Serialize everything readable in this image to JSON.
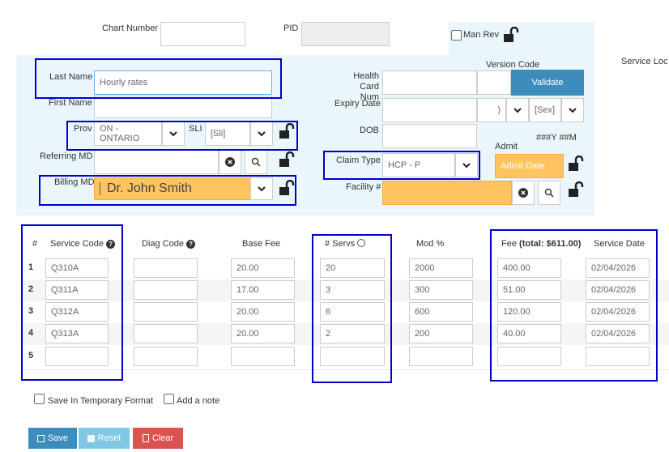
{
  "header": {
    "chart_number_label": "Chart Number",
    "pid_label": "PID",
    "man_rev_label": "Man Rev",
    "version_code_label": "Version Code",
    "service_loc_label": "Service Loc"
  },
  "form": {
    "last_name_label": "Last Name",
    "last_name_value": "Hourly rates",
    "first_name_label": "First Name",
    "prov_label": "Prov",
    "prov_value": "ON - ONTARIO",
    "sli_label": "SLI",
    "sli_value": "[Sli]",
    "referring_md_label": "Referring MD",
    "billing_md_label": "Billing MD",
    "billing_md_value": "Dr. John Smith",
    "health_card_label_1": "Health Card",
    "health_card_label_2": "Num",
    "validate_label": "Validate",
    "expiry_date_label": "Expiry Date",
    "expiry_suffix": ")",
    "sex_value": "[Sex]",
    "dob_label": "DOB",
    "dob_format": "###Y ##M",
    "admit_label": "Admit",
    "claim_type_label": "Claim Type",
    "claim_type_value": "HCP - P",
    "admit_date_placeholder": "Admit Date",
    "facility_label": "Facility #"
  },
  "table": {
    "headers": {
      "num": "#",
      "service_code": "Service Code",
      "diag_code": "Diag Code",
      "base_fee": "Base Fee",
      "servs": "# Servs",
      "mod": "Mod %",
      "fee": "Fee",
      "fee_total": "(total: $611.00)",
      "service_date": "Service Date"
    },
    "rows": [
      {
        "num": "1",
        "code": "Q310A",
        "diag": "",
        "base_fee": "20.00",
        "servs": "20",
        "mod": "2000",
        "fee": "400.00",
        "date": "02/04/2026"
      },
      {
        "num": "2",
        "code": "Q311A",
        "diag": "",
        "base_fee": "17.00",
        "servs": "3",
        "mod": "300",
        "fee": "51.00",
        "date": "02/04/2026"
      },
      {
        "num": "3",
        "code": "Q312A",
        "diag": "",
        "base_fee": "20.00",
        "servs": "6",
        "mod": "600",
        "fee": "120.00",
        "date": "02/04/2026"
      },
      {
        "num": "4",
        "code": "Q313A",
        "diag": "",
        "base_fee": "20.00",
        "servs": "2",
        "mod": "200",
        "fee": "40.00",
        "date": "02/04/2026"
      },
      {
        "num": "5",
        "code": "",
        "diag": "",
        "base_fee": "",
        "servs": "",
        "mod": "",
        "fee": "",
        "date": ""
      }
    ]
  },
  "options": {
    "save_temp_label": "Save In Temporary Format",
    "add_note_label": "Add a note"
  },
  "actions": {
    "save_label": "Save",
    "reset_label": "Reset",
    "clear_label": "Clear"
  },
  "colors": {
    "panel_bg": "#eaf6fb",
    "highlight_orange": "#fdc45f",
    "validate_blue": "#3c8dbc",
    "save_blue": "#3c8dbc",
    "reset_blue": "#7ec8e3",
    "clear_red": "#d9534f",
    "annotation_border": "#0000cc"
  }
}
